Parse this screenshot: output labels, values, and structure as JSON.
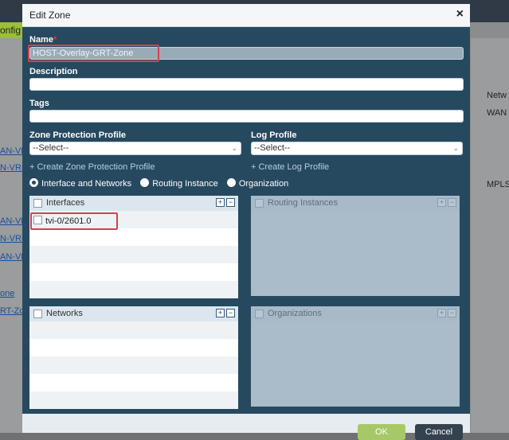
{
  "background": {
    "config_tab": "onfig",
    "left_links": [
      "AN-VR-",
      "N-VR-",
      "AN-VR-",
      "N-VR-",
      "AN-VR-",
      "one",
      "RT-Zo"
    ],
    "right_cells": [
      "Netw",
      "WAN",
      "MPLS"
    ]
  },
  "modal": {
    "title": "Edit Zone",
    "close": "×",
    "name_label": "Name",
    "required_mark": "*",
    "name_value": "HOST-Overlay-GRT-Zone",
    "description_label": "Description",
    "tags_label": "Tags",
    "zone_protection_label": "Zone Protection Profile",
    "zone_protection_value": "--Select--",
    "log_profile_label": "Log Profile",
    "log_profile_value": "--Select--",
    "create_zone_protection": "+ Create Zone Protection Profile",
    "create_log_profile": "+ Create Log Profile",
    "radio_options": [
      "Interface and Networks",
      "Routing Instance",
      "Organization"
    ],
    "panels": {
      "interfaces": {
        "title": "Interfaces",
        "items": [
          "tvi-0/2601.0"
        ]
      },
      "routing_instances": {
        "title": "Routing Instances"
      },
      "networks": {
        "title": "Networks"
      },
      "organizations": {
        "title": "Organizations"
      }
    },
    "ok_button": "OK",
    "cancel_button": "Cancel"
  },
  "colors": {
    "modal_bg": "#26495f",
    "highlight": "#d64050",
    "ok_button": "#a7c867",
    "cancel_button": "#33424e"
  }
}
